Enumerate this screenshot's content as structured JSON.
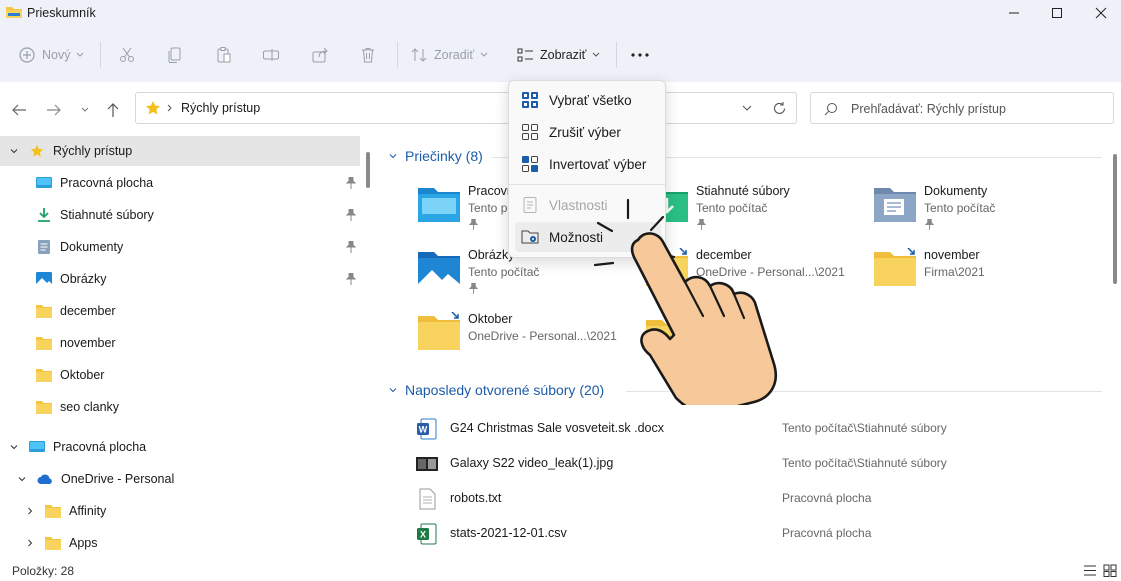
{
  "window": {
    "title": "Prieskumník"
  },
  "toolbar": {
    "new_label": "Nový",
    "sort_label": "Zoradiť",
    "view_label": "Zobraziť"
  },
  "address": {
    "path": "Rýchly prístup"
  },
  "search": {
    "placeholder": "Prehľadávať: Rýchly prístup"
  },
  "sidebar": {
    "quick_access": "Rýchly prístup",
    "pinned": [
      {
        "label": "Pracovná plocha",
        "icon": "desktop-icon"
      },
      {
        "label": "Stiahnuté súbory",
        "icon": "download-icon"
      },
      {
        "label": "Dokumenty",
        "icon": "documents-icon"
      },
      {
        "label": "Obrázky",
        "icon": "pictures-icon"
      }
    ],
    "recent_folders": [
      "december",
      "november",
      "Oktober",
      "seo clanky"
    ],
    "desktop": "Pracovná plocha",
    "onedrive": "OneDrive - Personal",
    "onedrive_children": [
      "Affinity",
      "Apps"
    ]
  },
  "main": {
    "folders_header": "Priečinky (8)",
    "folders": [
      {
        "name": "Pracovná plocha",
        "sub": "Tento počítač",
        "pinned": true
      },
      {
        "name": "Stiahnuté súbory",
        "sub": "Tento počítač",
        "pinned": true
      },
      {
        "name": "Dokumenty",
        "sub": "Tento počítač",
        "pinned": true
      },
      {
        "name": "Obrázky",
        "sub": "Tento počítač",
        "pinned": true
      },
      {
        "name": "december",
        "sub": "OneDrive - Personal...\\2021",
        "pinned": false
      },
      {
        "name": "november",
        "sub": "Firma\\2021",
        "pinned": false
      },
      {
        "name": "Oktober",
        "sub": "OneDrive - Personal...\\2021",
        "pinned": false
      }
    ],
    "recent_header": "Naposledy otvorené súbory (20)",
    "recent_files": [
      {
        "name": "G24 Christmas Sale vosveteit.sk .docx",
        "location": "Tento počítač\\Stiahnuté súbory",
        "icon": "word-icon"
      },
      {
        "name": "Galaxy S22 video_leak(1).jpg",
        "location": "Tento počítač\\Stiahnuté súbory",
        "icon": "image-file-icon"
      },
      {
        "name": "robots.txt",
        "location": "Pracovná plocha",
        "icon": "text-file-icon"
      },
      {
        "name": "stats-2021-12-01.csv",
        "location": "Pracovná plocha",
        "icon": "excel-icon"
      }
    ]
  },
  "menu": {
    "items": [
      {
        "label": "Vybrať všetko",
        "enabled": true
      },
      {
        "label": "Zrušiť výber",
        "enabled": true
      },
      {
        "label": "Invertovať výber",
        "enabled": true
      },
      {
        "label": "Vlastnosti",
        "enabled": false
      },
      {
        "label": "Možnosti",
        "enabled": true
      }
    ]
  },
  "status": {
    "items_text": "Položky: 28"
  },
  "colors": {
    "accent": "#1c5ca8",
    "folder": "#f8d35e",
    "bar": "#eef2f8"
  }
}
